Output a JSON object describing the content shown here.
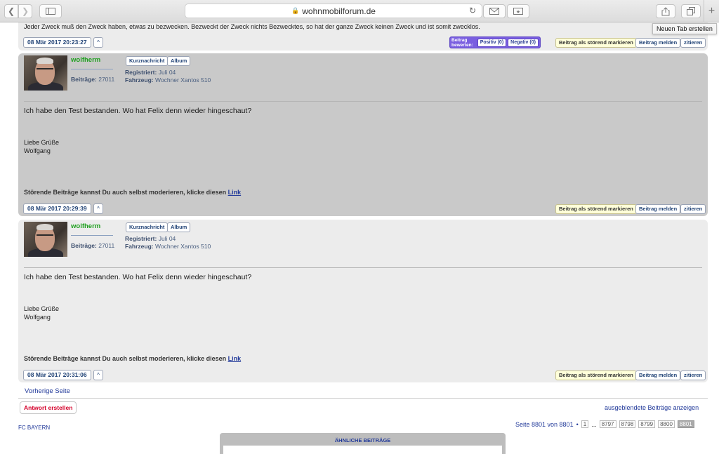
{
  "browser": {
    "url": "wohnmobilforum.de",
    "tooltip": "Neuen Tab erstellen"
  },
  "top_post": {
    "text": "Jeder Zweck muß den Zweck haben, etwas zu bezwecken. Bezweckt der Zweck nichts Bezwecktes, so hat der ganze Zweck keinen Zweck und ist somit zwecklos.",
    "date": "08 Mär 2017 20:23:27",
    "rating_label_1": "Beitrag",
    "rating_label_2": "bewerten:",
    "positive": "Positiv (0)",
    "negative": "Negativ (0)"
  },
  "buttons": {
    "up": "^",
    "mark_disruptive": "Beitrag als störend markieren",
    "report": "Beitrag melden",
    "quote": "zitieren",
    "pm": "Kurznachricht",
    "album": "Album"
  },
  "posts": [
    {
      "user": "wolfherm",
      "posts_label": "Beiträge:",
      "posts_count": "27011",
      "registered_label": "Registriert:",
      "registered": "Juli 04",
      "vehicle_label": "Fahrzeug:",
      "vehicle": "Wochner Xantos 510",
      "text": "Ich habe den Test bestanden. Wo hat Felix denn wieder hingeschaut?",
      "greeting1": "Liebe Grüße",
      "greeting2": "Wolfgang",
      "footer": "Störende Beiträge kannst Du auch selbst moderieren, klicke diesen",
      "footer_link": "Link",
      "date": "08 Mär 2017 20:29:39"
    },
    {
      "user": "wolfherm",
      "posts_label": "Beiträge:",
      "posts_count": "27011",
      "registered_label": "Registriert:",
      "registered": "Juli 04",
      "vehicle_label": "Fahrzeug:",
      "vehicle": "Wochner Xantos 510",
      "text": "Ich habe den Test bestanden. Wo hat Felix denn wieder hingeschaut?",
      "greeting1": "Liebe Grüße",
      "greeting2": "Wolfgang",
      "footer": "Störende Beiträge kannst Du auch selbst moderieren, klicke diesen",
      "footer_link": "Link",
      "date": "08 Mär 2017 20:31:06"
    }
  ],
  "nav": {
    "prev_page": "Vorherige Seite",
    "reply": "Antwort erstellen",
    "show_hidden": "ausgeblendete Beiträge anzeigen",
    "board": "FC BAYERN",
    "page_info": "Seite 8801 von 8801",
    "bullet": "•",
    "ellipsis": "...",
    "pages": [
      "1",
      "8797",
      "8798",
      "8799",
      "8800",
      "8801"
    ],
    "similar_title": "ÄHNLICHE BEITRÄGE"
  },
  "colors": {
    "username": "#1fa01f",
    "link": "#223a9a",
    "rating": "#7a5fe0",
    "reply": "#d4002a"
  }
}
